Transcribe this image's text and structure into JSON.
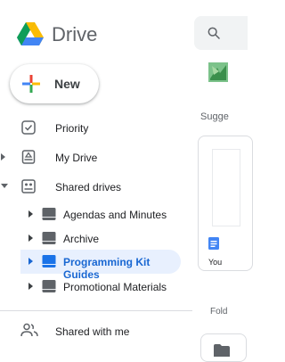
{
  "app": {
    "name": "Drive"
  },
  "new_button": {
    "label": "New"
  },
  "nav": {
    "priority": "Priority",
    "my_drive": "My Drive",
    "shared_drives": "Shared drives",
    "shared_drive_items": [
      "Agendas and Minutes",
      "Archive",
      "Programming Kit Guides",
      "Promotional Materials"
    ],
    "selected_index": 2,
    "shared_with_me": "Shared with me"
  },
  "main": {
    "suggested_label": "Sugge",
    "card_owner_text": "You",
    "folders_label": "Fold"
  },
  "colors": {
    "highlight_bg": "#e8f0fe",
    "highlight_text": "#1967d2",
    "drive_icon_default": "#5f6368",
    "drive_icon_selected": "#1a73e8"
  }
}
